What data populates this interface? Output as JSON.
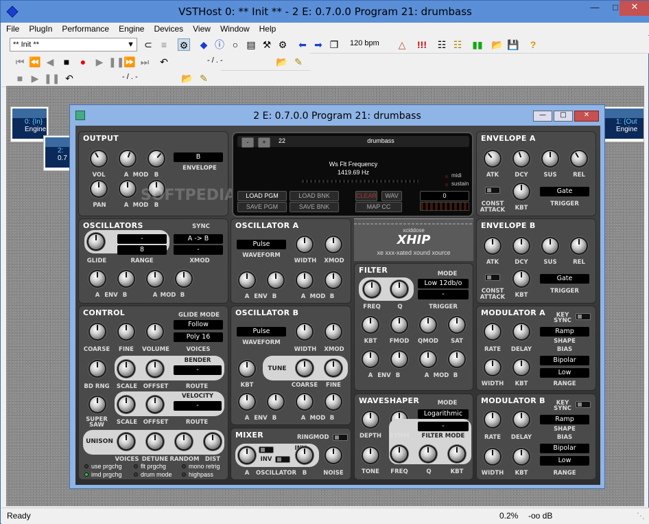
{
  "app": {
    "title": "VSTHost 0: ** Init ** - 2 E: 0.7.0.0 Program 21: drumbass"
  },
  "menu": [
    "File",
    "PlugIn",
    "Performance",
    "Engine",
    "Devices",
    "View",
    "Window",
    "Help"
  ],
  "toolbar": {
    "program_select": "** Init **",
    "bpm": "120 bpm"
  },
  "transport": {
    "time1": "- / . -",
    "time2": "- / . -"
  },
  "status": {
    "left": "Ready",
    "cpu": "0.2%",
    "level": "-oo dB"
  },
  "nodes": {
    "in_label": "0: {In}",
    "in_sub": "Engine",
    "out_label": "1: {Out",
    "out_sub": "Engine",
    "mid_label": "2:",
    "mid_sub": "0.7"
  },
  "plugin": {
    "title": "2 E: 0.7.0.0 Program 21: drumbass",
    "watermark": "SOFTPEDIA",
    "output": {
      "title": "OUTPUT",
      "envelope_value": "B",
      "envelope": "ENVELOPE",
      "vol": "VOL",
      "a": "A",
      "mod": "MOD",
      "b": "B",
      "pan": "PAN"
    },
    "program": {
      "minus": "-",
      "plus": "+",
      "number": "22",
      "name": "drumbass",
      "param": "Ws Flt Frequency",
      "value": "1419.69 Hz",
      "midi": "midi",
      "sustain": "sustain",
      "load_pgm": "LOAD PGM",
      "load_bnk": "LOAD BNK",
      "clear": "CLEAR",
      "wav": "WAV",
      "save_pgm": "SAVE PGM",
      "save_bnk": "SAVE BNK",
      "map_cc": "MAP CC",
      "cc_value": "0"
    },
    "env_a": {
      "title": "ENVELOPE A",
      "atk": "ATK",
      "dcy": "DCY",
      "sus": "SUS",
      "rel": "REL",
      "const": "CONST",
      "attack": "ATTACK",
      "kbt": "KBT",
      "trigger_value": "Gate",
      "trigger": "TRIGGER"
    },
    "env_b": {
      "title": "ENVELOPE B",
      "atk": "ATK",
      "dcy": "DCY",
      "sus": "SUS",
      "rel": "REL",
      "const": "CONST",
      "attack": "ATTACK",
      "kbt": "KBT",
      "trigger_value": "Gate",
      "trigger": "TRIGGER"
    },
    "oscillators": {
      "title": "OSCILLATORS",
      "sync": "SYNC",
      "glide_val": "-",
      "sync_val": "A -> B",
      "range_val": "8",
      "xmod_val": "-",
      "glide": "GLIDE",
      "range": "RANGE",
      "xmod": "XMOD",
      "a": "A",
      "env": "ENV",
      "b": "B",
      "mod": "MOD"
    },
    "osc_a": {
      "title": "OSCILLATOR A",
      "waveform_value": "Pulse",
      "waveform": "WAVEFORM",
      "width": "WIDTH",
      "xmod": "XMOD",
      "a": "A",
      "env": "ENV",
      "b": "B",
      "mod": "MOD"
    },
    "osc_b": {
      "title": "OSCILLATOR B",
      "waveform_value": "Pulse",
      "waveform": "WAVEFORM",
      "width": "WIDTH",
      "xmod": "XMOD",
      "kbt": "KBT",
      "tune": "TUNE",
      "coarse": "COARSE",
      "fine": "FINE",
      "a": "A",
      "env": "ENV",
      "b": "B",
      "mod": "MOD"
    },
    "logo": {
      "top": "xciddose",
      "main": "XHIP",
      "sub": "xe xxx-xated xound xource"
    },
    "filter": {
      "title": "FILTER",
      "mode": "MODE",
      "mode_value": "Low 12db/o",
      "trigger_value": "-",
      "freq": "FREQ",
      "q": "Q",
      "trigger": "TRIGGER",
      "kbt": "KBT",
      "fmod": "FMOD",
      "qmod": "QMOD",
      "sat": "SAT",
      "a": "A",
      "env": "ENV",
      "b": "B",
      "mod": "MOD"
    },
    "control": {
      "title": "CONTROL",
      "glide_mode": "GLIDE MODE",
      "glide_value": "Follow",
      "voices_value": "Poly 16",
      "coarse": "COARSE",
      "fine": "FINE",
      "volume": "VOLUME",
      "voices": "VOICES",
      "bender": "BENDER",
      "bender_value": "-",
      "bd_rng": "BD RNG",
      "scale": "SCALE",
      "offset": "OFFSET",
      "route": "ROUTE",
      "velocity": "VELOCITY",
      "velocity_value": "-",
      "super": "SUPER",
      "saw": "SAW",
      "unison": "UNISON",
      "voices2": "VOICES",
      "detune": "DETUNE",
      "random": "RANDOM",
      "dist": "DIST",
      "opts": [
        "use prgchg",
        "flt prgchg",
        "mono retrig",
        "imd prgchg",
        "drum mode",
        "highpass"
      ]
    },
    "mixer": {
      "title": "MIXER",
      "ringmod": "RINGMOD",
      "inv": "INV",
      "a": "A",
      "oscillator": "OSCILLATOR",
      "b": "B",
      "noise": "NOISE"
    },
    "waveshaper": {
      "title": "WAVESHAPER",
      "mode": "MODE",
      "mode_value": "Logarithmic",
      "fmode_value": "-",
      "depth": "DEPTH",
      "symm": "SYMM",
      "filter_mode": "FILTER MODE",
      "tone": "TONE",
      "freq": "FREQ",
      "q": "Q",
      "kbt": "KBT"
    },
    "mod_a": {
      "title": "MODULATOR A",
      "key": "KEY",
      "sync": "SYNC",
      "shape_value": "Ramp",
      "shape": "SHAPE",
      "bias": "BIAS",
      "bias_value": "Bipolar",
      "rate": "RATE",
      "delay": "DELAY",
      "range_value": "Low",
      "width": "WIDTH",
      "kbt": "KBT",
      "range": "RANGE"
    },
    "mod_b": {
      "title": "MODULATOR B",
      "key": "KEY",
      "sync": "SYNC",
      "shape_value": "Ramp",
      "shape": "SHAPE",
      "bias": "BIAS",
      "bias_value": "Bipolar",
      "rate": "RATE",
      "delay": "DELAY",
      "range_value": "Low",
      "width": "WIDTH",
      "kbt": "KBT",
      "range": "RANGE"
    }
  }
}
